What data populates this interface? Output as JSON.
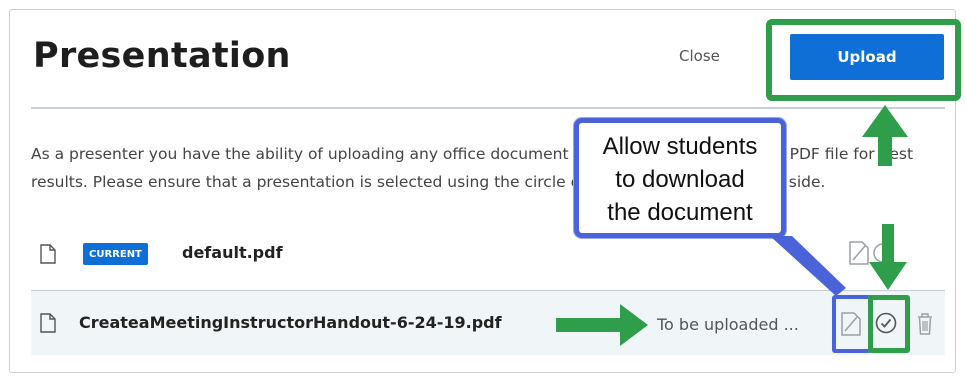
{
  "dialog": {
    "title": "Presentation",
    "close_label": "Close",
    "upload_label": "Upload",
    "description": "As a presenter you have the ability of uploading any office document or PDF file. We recommend PDF file for best results. Please ensure that a presentation is selected using the circle checkbox on the right hand side."
  },
  "files": [
    {
      "badge": "CURRENT",
      "name": "default.pdf"
    },
    {
      "name": "CreateaMeetingInstructorHandout-6-24-19.pdf",
      "status": "To be uploaded ..."
    }
  ],
  "annotation": {
    "callout_text": "Allow students\nto download\nthe document"
  },
  "icons": {
    "file": "file-icon",
    "download_toggle": "download-toggle-icon",
    "select_circle": "select-circle-icon",
    "trash": "trash-icon"
  },
  "colors": {
    "accent": "#0f6fd6",
    "highlight_green": "#2e9e4a",
    "highlight_blue": "#4a63d9"
  }
}
